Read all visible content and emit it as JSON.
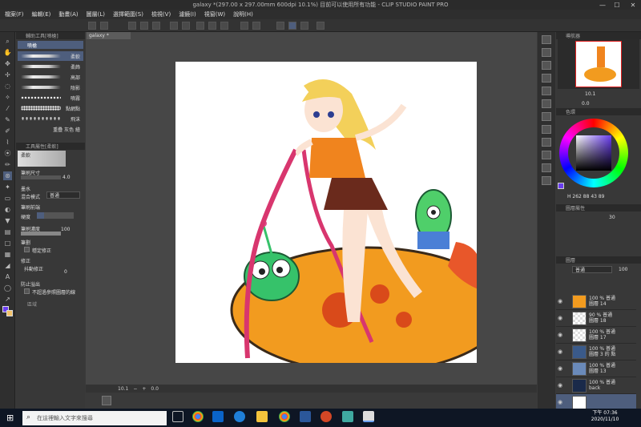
{
  "window": {
    "title": "galaxy *(297.00 x 297.00mm 600dpi 10.1%)  目前可以使用所有功能 - CLIP STUDIO PAINT PRO",
    "minimize": "—",
    "maximize": "☐",
    "close": "✕"
  },
  "menu": [
    "檔案(F)",
    "編輯(E)",
    "動畫(A)",
    "圖層(L)",
    "選擇範圍(S)",
    "檢視(V)",
    "濾鏡(I)",
    "視窗(W)",
    "說明(H)"
  ],
  "subtool": {
    "header": "輔助工具[噴槍]",
    "group": "噴槍",
    "brushes": [
      "柔軟",
      "柔飾",
      "高部",
      "陰影",
      "噴霧",
      "點網點",
      "飛沫",
      "重疊 灰色 繪"
    ]
  },
  "toolprop": {
    "header": "工具屬性[柔軟]",
    "preview_label": "柔軟",
    "brush_size_label": "筆刷尺寸",
    "brush_size": "4.0",
    "blend_label": "墨水",
    "blend_mode_label": "混合模式",
    "blend_mode": "普通",
    "brush_tip_label": "筆刷前端",
    "hardness_label": "硬度",
    "density_label": "筆刷濃度",
    "density": "100",
    "spray_label": "筆劃",
    "stabilize_label": "穩定修正",
    "correction_label": "修正",
    "correction_sub": "抖動修正",
    "correction_value": "0",
    "antioverflow_label": "防止溢出",
    "no_overflow_label": "不超過參照圖層的線",
    "ref_area_label": "區域"
  },
  "document": {
    "tab": "galaxy *",
    "zoom": "10.1",
    "status_coords": "0.0"
  },
  "navigator": {
    "header": "導航器",
    "zoom": "10.1",
    "angle": "0.0"
  },
  "color": {
    "header": "色環",
    "hsv": "H 262 88 43 89",
    "accent": "#6a3df0"
  },
  "layer_prop": {
    "header": "圖層屬性",
    "opacity": "30"
  },
  "layers_panel": {
    "header": "圖層",
    "blend": "普通",
    "opacity": "100"
  },
  "layers": [
    {
      "line1": "100 % 普通",
      "line2": "圖層 14"
    },
    {
      "line1": "90 % 普通",
      "line2": "圖層 18"
    },
    {
      "line1": "100 % 普通",
      "line2": "圖層 17"
    },
    {
      "line1": "100 % 普通",
      "line2": "圖層 3 的 點"
    },
    {
      "line1": "100 % 普通",
      "line2": "圖層 13"
    },
    {
      "line1": "100 % 普通",
      "line2": "back"
    }
  ],
  "taskbar": {
    "search_placeholder": "在這裡輸入文字來搜尋",
    "time": "下午 07:36",
    "date": "2020/11/10"
  }
}
